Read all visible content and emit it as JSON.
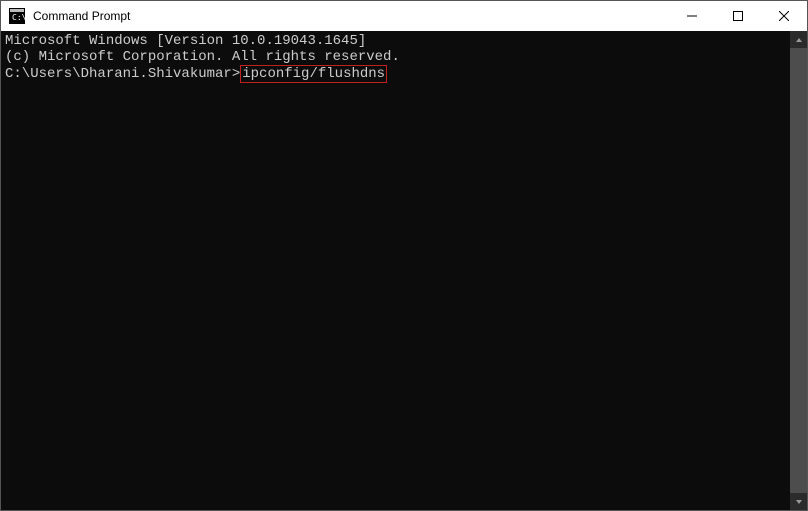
{
  "window": {
    "title": "Command Prompt"
  },
  "terminal": {
    "line1": "Microsoft Windows [Version 10.0.19043.1645]",
    "line2": "(c) Microsoft Corporation. All rights reserved.",
    "blank": "",
    "prompt": "C:\\Users\\Dharani.Shivakumar>",
    "command": "ipconfig/flushdns"
  }
}
